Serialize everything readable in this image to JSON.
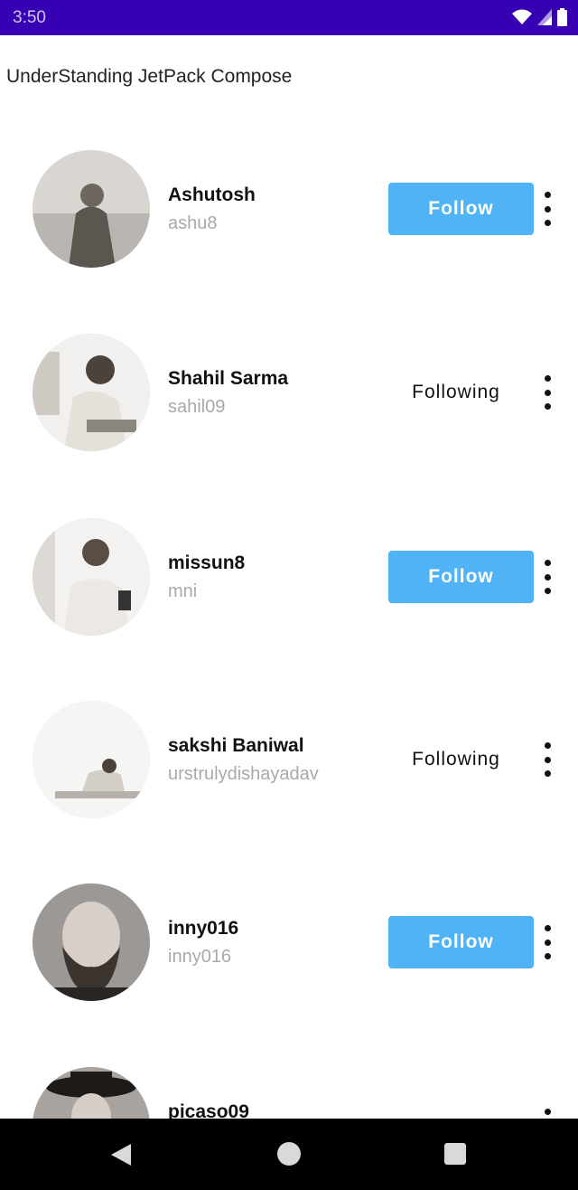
{
  "status_bar": {
    "time": "3:50",
    "icons": [
      "wifi-icon",
      "signal-icon",
      "battery-icon"
    ],
    "background": "#3700b3"
  },
  "app_bar": {
    "title": "UnderStanding JetPack Compose"
  },
  "users": [
    {
      "name": "Ashutosh",
      "username": "ashu8",
      "action": "Follow",
      "followed": false,
      "avatar": "avatar-photo-woman-scarf"
    },
    {
      "name": "Shahil Sarma",
      "username": "sahil09",
      "action": "Following",
      "followed": true,
      "avatar": "avatar-photo-woman-laptop"
    },
    {
      "name": "missun8",
      "username": "mni",
      "action": "Follow",
      "followed": false,
      "avatar": "avatar-photo-woman-phone"
    },
    {
      "name": "sakshi Baniwal",
      "username": "urstrulydishayadav",
      "action": "Following",
      "followed": true,
      "avatar": "avatar-photo-woman-desk"
    },
    {
      "name": "inny016",
      "username": "inny016",
      "action": "Follow",
      "followed": false,
      "avatar": "avatar-photo-bearded-man"
    },
    {
      "name": "picaso09",
      "username": "",
      "action": "",
      "followed": false,
      "avatar": "avatar-photo-person-hat"
    }
  ],
  "more_icon": "more-vert-icon",
  "nav_bar": {
    "icons": [
      "back-icon",
      "home-icon",
      "recents-icon"
    ]
  },
  "colors": {
    "accent": "#4fb3f6",
    "status_bar": "#3700b3",
    "username": "#a9a9a9",
    "nav_bar": "#000000"
  }
}
